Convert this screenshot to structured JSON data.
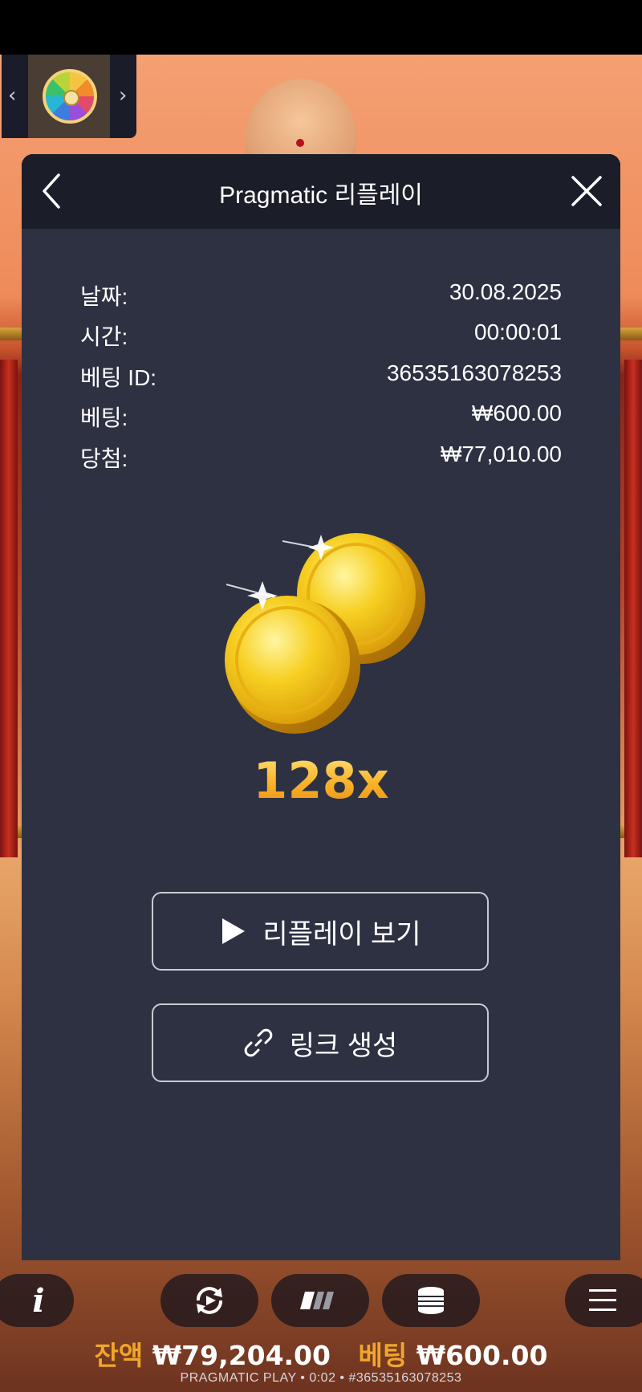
{
  "colors": {
    "modal_bg": "#2e3142",
    "header_bg": "#1b1d29",
    "accent_gold": "#f0a62a",
    "text": "#ffffff"
  },
  "header": {
    "title": "Pragmatic 리플레이",
    "back_icon": "chevron-left-icon",
    "close_icon": "close-icon"
  },
  "details": {
    "date_label": "날짜:",
    "date_value": "30.08.2025",
    "time_label": "시간:",
    "time_value": "00:00:01",
    "bet_id_label": "베팅 ID:",
    "bet_id_value": "36535163078253",
    "bet_label": "베팅:",
    "bet_value": "₩600.00",
    "win_label": "당첨:",
    "win_value": "₩77,010.00"
  },
  "result": {
    "multiplier": "128x",
    "icon": "gold-coins-icon"
  },
  "actions": {
    "watch_replay": "리플레이 보기",
    "watch_icon": "play-icon",
    "create_link": "링크 생성",
    "link_icon": "link-icon"
  },
  "bottom_bar": {
    "info_icon": "info-icon",
    "autoplay_icon": "autoplay-icon",
    "turbo_icon": "turbo-icon",
    "bet_icon": "coins-stack-icon",
    "menu_icon": "menu-icon",
    "balance_label": "잔액",
    "balance_value": "₩79,204.00",
    "bet_label": "베팅",
    "bet_value": "₩600.00",
    "footer": "PRAGMATIC PLAY • 0:02 • #36535163078253"
  }
}
